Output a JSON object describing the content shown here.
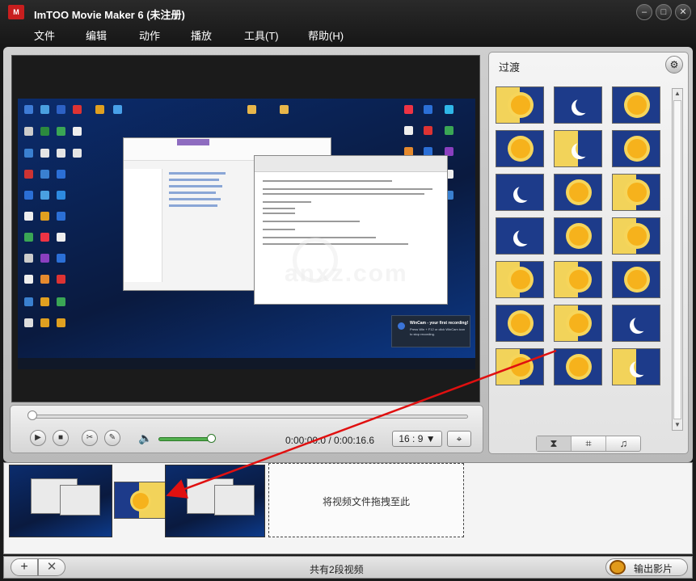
{
  "window": {
    "title": "ImTOO Movie Maker 6 (未注册)",
    "logo_text": "M"
  },
  "menu": [
    "文件",
    "编辑",
    "动作",
    "播放",
    "工具(T)",
    "帮助(H)"
  ],
  "preview": {
    "watermark": "anxz.com",
    "toast": {
      "title": "WinCam - your first recording!",
      "text": "Press Win + F12 or click WinCam icon to stop recording."
    }
  },
  "transport": {
    "timecode": "0:00:00.0 / 0:00:16.6",
    "aspect_ratio": "16 : 9",
    "progress": 0
  },
  "transitions": {
    "title": "过渡",
    "tile_count": 21
  },
  "storyboard": {
    "drop_text": "将视频文件拖拽至此"
  },
  "bottom": {
    "clip_count": "共有2段视频",
    "export_label": "输出影片"
  }
}
